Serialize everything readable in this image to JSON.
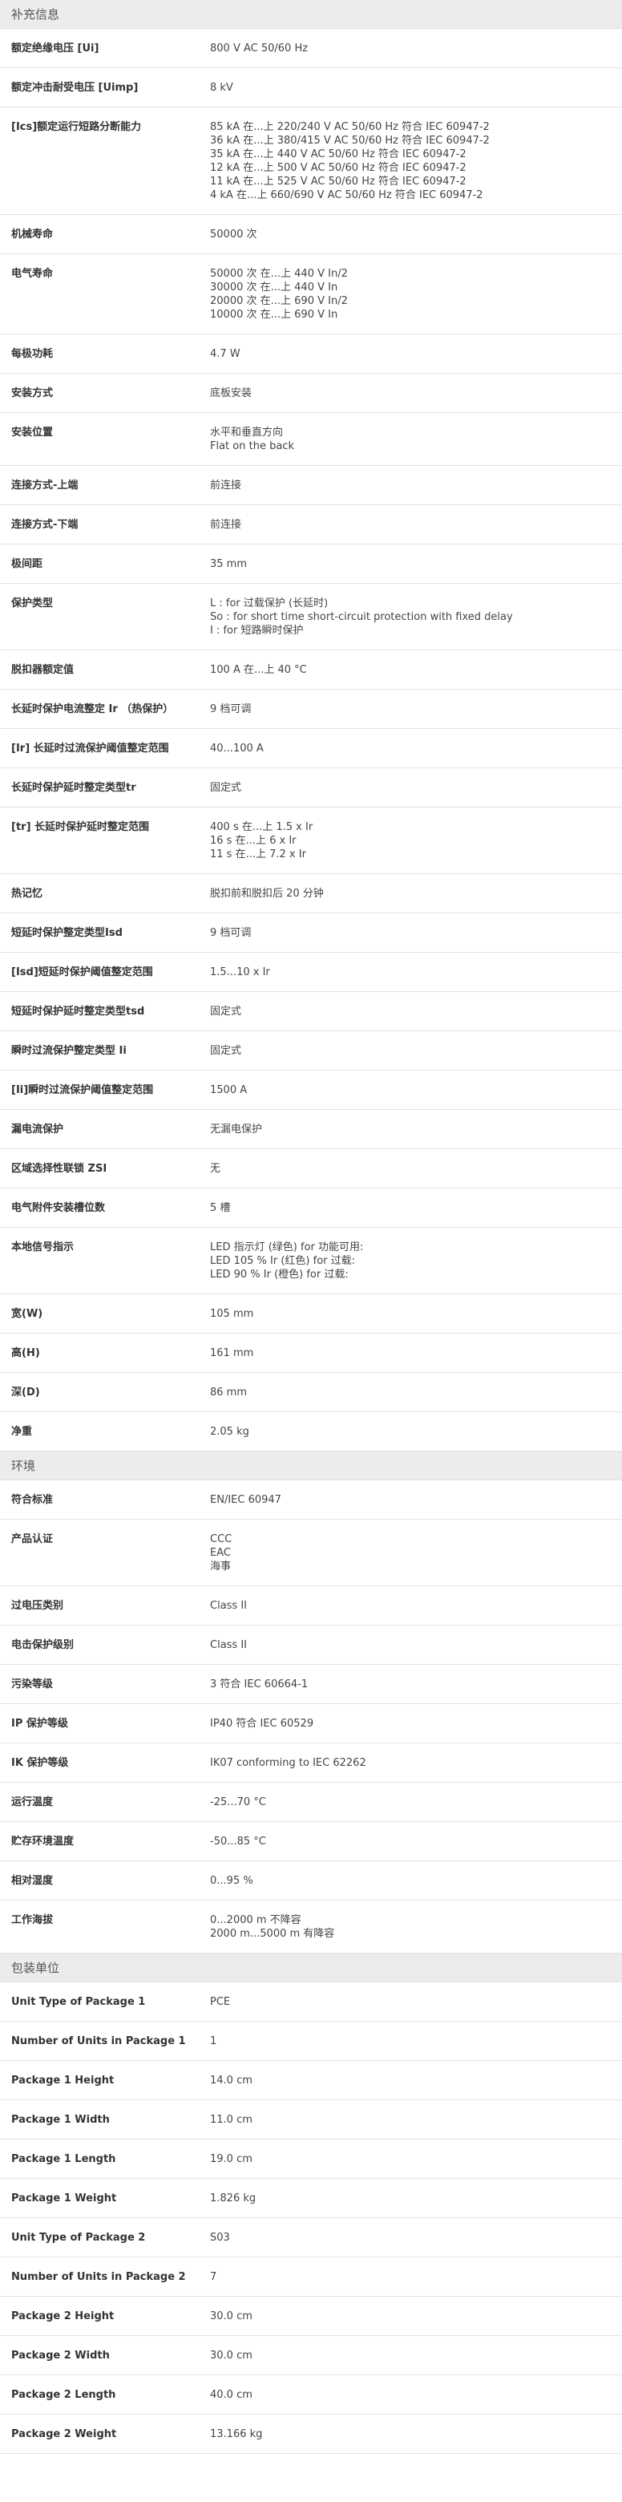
{
  "sections": [
    {
      "title": "补充信息",
      "rows": [
        {
          "label": "额定绝缘电压 [Ui]",
          "values": [
            "800 V AC 50/60 Hz"
          ]
        },
        {
          "label": "额定冲击耐受电压 [Uimp]",
          "values": [
            "8 kV"
          ]
        },
        {
          "label": "[Ics]额定运行短路分断能力",
          "values": [
            "85 kA 在...上 220/240 V AC 50/60 Hz 符合 IEC 60947-2",
            "36 kA 在...上 380/415 V AC 50/60 Hz 符合 IEC 60947-2",
            "35 kA 在...上 440 V AC 50/60 Hz 符合 IEC 60947-2",
            "12 kA 在...上 500 V AC 50/60 Hz 符合 IEC 60947-2",
            "11 kA 在...上 525 V AC 50/60 Hz 符合 IEC 60947-2",
            "4 kA 在...上 660/690 V AC 50/60 Hz 符合 IEC 60947-2"
          ]
        },
        {
          "label": "机械寿命",
          "values": [
            "50000 次"
          ]
        },
        {
          "label": "电气寿命",
          "values": [
            "50000 次 在...上 440 V In/2",
            "30000 次 在...上 440 V In",
            "20000 次 在...上 690 V In/2",
            "10000 次 在...上 690 V In"
          ]
        },
        {
          "label": "每极功耗",
          "values": [
            "4.7 W"
          ]
        },
        {
          "label": "安装方式",
          "values": [
            "底板安装"
          ]
        },
        {
          "label": "安装位置",
          "values": [
            "水平和垂直方向",
            "Flat on the back"
          ]
        },
        {
          "label": "连接方式-上端",
          "values": [
            "前连接"
          ]
        },
        {
          "label": "连接方式-下端",
          "values": [
            "前连接"
          ]
        },
        {
          "label": "极间距",
          "values": [
            "35 mm"
          ]
        },
        {
          "label": "保护类型",
          "values": [
            "L : for 过载保护 (长延时)",
            "So : for short time short-circuit protection with fixed delay",
            "I : for 短路瞬时保护"
          ]
        },
        {
          "label": "脱扣器额定值",
          "values": [
            "100 A 在...上 40 °C"
          ]
        },
        {
          "label": "长延时保护电流整定 Ir （热保护）",
          "values": [
            "9 档可调"
          ]
        },
        {
          "label": "[Ir] 长延时过流保护阈值整定范围",
          "values": [
            "40...100 A"
          ]
        },
        {
          "label": "长延时保护延时整定类型tr",
          "values": [
            "固定式"
          ]
        },
        {
          "label": "[tr] 长延时保护延时整定范围",
          "values": [
            "400 s 在...上 1.5 x Ir",
            "16 s 在...上 6 x Ir",
            "11 s 在...上 7.2 x Ir"
          ]
        },
        {
          "label": "热记忆",
          "values": [
            "脱扣前和脱扣后 20 分钟"
          ]
        },
        {
          "label": "短延时保护整定类型Isd",
          "values": [
            "9 档可调"
          ]
        },
        {
          "label": "[Isd]短延时保护阈值整定范围",
          "values": [
            "1.5...10 x Ir"
          ]
        },
        {
          "label": "短延时保护延时整定类型tsd",
          "values": [
            "固定式"
          ]
        },
        {
          "label": "瞬时过流保护整定类型 Ii",
          "values": [
            "固定式"
          ]
        },
        {
          "label": "[Ii]瞬时过流保护阈值整定范围",
          "values": [
            "1500 A"
          ]
        },
        {
          "label": "漏电流保护",
          "values": [
            "无漏电保护"
          ]
        },
        {
          "label": "区域选择性联锁 ZSI",
          "values": [
            "无"
          ]
        },
        {
          "label": "电气附件安装槽位数",
          "values": [
            "5 槽"
          ]
        },
        {
          "label": "本地信号指示",
          "values": [
            "LED 指示灯 (绿色) for 功能可用:",
            "LED 105 % Ir (红色) for 过载:",
            "LED 90 % Ir (橙色) for 过载:"
          ]
        },
        {
          "label": "宽(W)",
          "values": [
            "105 mm"
          ]
        },
        {
          "label": "高(H)",
          "values": [
            "161 mm"
          ]
        },
        {
          "label": "深(D)",
          "values": [
            "86 mm"
          ]
        },
        {
          "label": "净重",
          "values": [
            "2.05 kg"
          ]
        }
      ]
    },
    {
      "title": "环境",
      "rows": [
        {
          "label": "符合标准",
          "values": [
            "EN/IEC 60947"
          ]
        },
        {
          "label": "产品认证",
          "values": [
            "CCC",
            "EAC",
            "海事"
          ]
        },
        {
          "label": "过电压类别",
          "values": [
            "Class II"
          ]
        },
        {
          "label": "电击保护级别",
          "values": [
            "Class II"
          ]
        },
        {
          "label": "污染等级",
          "values": [
            "3 符合 IEC 60664-1"
          ]
        },
        {
          "label": "IP 保护等级",
          "values": [
            "IP40 符合 IEC 60529"
          ]
        },
        {
          "label": "IK 保护等级",
          "values": [
            "IK07 conforming to IEC 62262"
          ]
        },
        {
          "label": "运行温度",
          "values": [
            "-25...70 °C"
          ]
        },
        {
          "label": "贮存环境温度",
          "values": [
            "-50...85 °C"
          ]
        },
        {
          "label": "相对湿度",
          "values": [
            "0...95 %"
          ]
        },
        {
          "label": "工作海拔",
          "values": [
            "0...2000 m 不降容",
            "2000 m...5000 m 有降容"
          ]
        }
      ]
    },
    {
      "title": "包装单位",
      "rows": [
        {
          "label": "Unit Type of Package 1",
          "values": [
            "PCE"
          ]
        },
        {
          "label": "Number of Units in Package 1",
          "values": [
            "1"
          ]
        },
        {
          "label": "Package 1 Height",
          "values": [
            "14.0 cm"
          ]
        },
        {
          "label": "Package 1 Width",
          "values": [
            "11.0 cm"
          ]
        },
        {
          "label": "Package 1 Length",
          "values": [
            "19.0 cm"
          ]
        },
        {
          "label": "Package 1 Weight",
          "values": [
            "1.826 kg"
          ]
        },
        {
          "label": "Unit Type of Package 2",
          "values": [
            "S03"
          ]
        },
        {
          "label": "Number of Units in Package 2",
          "values": [
            "7"
          ]
        },
        {
          "label": "Package 2 Height",
          "values": [
            "30.0 cm"
          ]
        },
        {
          "label": "Package 2 Width",
          "values": [
            "30.0 cm"
          ]
        },
        {
          "label": "Package 2 Length",
          "values": [
            "40.0 cm"
          ]
        },
        {
          "label": "Package 2 Weight",
          "values": [
            "13.166 kg"
          ]
        }
      ]
    }
  ]
}
